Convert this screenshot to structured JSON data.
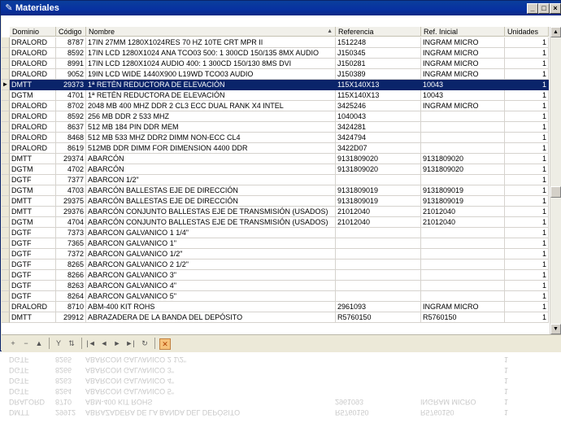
{
  "window": {
    "title": "Materiales",
    "app_icon": "pencil-icon",
    "controls": {
      "minimize": "_",
      "maximize": "□",
      "close": "×"
    }
  },
  "grid": {
    "columns": [
      "Dominio",
      "Código",
      "Nombre",
      "Referencia",
      "Ref. Inicial",
      "Unidades"
    ],
    "sort_indicator": "▲",
    "selected_row_marker": "►",
    "rows": [
      {
        "dominio": "DRALORD",
        "codigo": "8787",
        "nombre": "17IN 27MM 1280X1024RES 70 HZ 10TE CRT MPR II",
        "referencia": "1512248",
        "ref_inicial": "INGRAM MICRO",
        "unidades": "1"
      },
      {
        "dominio": "DRALORD",
        "codigo": "8592",
        "nombre": "17IN LCD 1280X1024 ANA TCO03 500: 1 300CD 150/135 8MX AUDIO",
        "referencia": "J150345",
        "ref_inicial": "INGRAM MICRO",
        "unidades": "1"
      },
      {
        "dominio": "DRALORD",
        "codigo": "8991",
        "nombre": "17IN LCD 1280X1024 AUDIO 400: 1 300CD 150/130 8MS DVI",
        "referencia": "J150281",
        "ref_inicial": "INGRAM MICRO",
        "unidades": "1"
      },
      {
        "dominio": "DRALORD",
        "codigo": "9052",
        "nombre": "19IN LCD WIDE 1440X900 L19WD TCO03 AUDIO",
        "referencia": "J150389",
        "ref_inicial": "INGRAM MICRO",
        "unidades": "1"
      },
      {
        "dominio": "DMTT",
        "codigo": "29373",
        "nombre": "1ª RETÉN REDUCTORA DE ELEVACIÓN",
        "referencia": "115X140X13",
        "ref_inicial": "10043",
        "unidades": "1"
      },
      {
        "dominio": "DGTM",
        "codigo": "4701",
        "nombre": "1ª RETÉN REDUCTORA DE ELEVACIÓN",
        "referencia": "115X140X13",
        "ref_inicial": "10043",
        "unidades": "1"
      },
      {
        "dominio": "DRALORD",
        "codigo": "8702",
        "nombre": "2048 MB 400 MHZ DDR 2 CL3 ECC DUAL RANK X4 INTEL",
        "referencia": "3425246",
        "ref_inicial": "INGRAM MICRO",
        "unidades": "1"
      },
      {
        "dominio": "DRALORD",
        "codigo": "8592",
        "nombre": "256 MB DDR 2 533 MHZ",
        "referencia": "1040043",
        "ref_inicial": "",
        "unidades": "1"
      },
      {
        "dominio": "DRALORD",
        "codigo": "8637",
        "nombre": "512 MB 184 PIN DDR  MEM",
        "referencia": "3424281",
        "ref_inicial": "",
        "unidades": "1"
      },
      {
        "dominio": "DRALORD",
        "codigo": "8468",
        "nombre": "512 MB 533 MHZ DDR2 DIMM NON-ECC CL4",
        "referencia": "3424794",
        "ref_inicial": "",
        "unidades": "1"
      },
      {
        "dominio": "DRALORD",
        "codigo": "8619",
        "nombre": "512MB DDR DIMM FOR DIMENSION 4400 DDR",
        "referencia": "3422D07",
        "ref_inicial": "",
        "unidades": "1"
      },
      {
        "dominio": "DMTT",
        "codigo": "29374",
        "nombre": "ABARCÓN",
        "referencia": "9131809020",
        "ref_inicial": "9131809020",
        "unidades": "1"
      },
      {
        "dominio": "DGTM",
        "codigo": "4702",
        "nombre": "ABARCÓN",
        "referencia": "9131809020",
        "ref_inicial": "9131809020",
        "unidades": "1"
      },
      {
        "dominio": "DGTF",
        "codigo": "7377",
        "nombre": "ABARCON 1/2\"",
        "referencia": "",
        "ref_inicial": "",
        "unidades": "1"
      },
      {
        "dominio": "DGTM",
        "codigo": "4703",
        "nombre": "ABARCÓN BALLESTAS EJE DE DIRECCIÓN",
        "referencia": "9131809019",
        "ref_inicial": "9131809019",
        "unidades": "1"
      },
      {
        "dominio": "DMTT",
        "codigo": "29375",
        "nombre": "ABARCÓN BALLESTAS EJE DE DIRECCIÓN",
        "referencia": "9131809019",
        "ref_inicial": "9131809019",
        "unidades": "1"
      },
      {
        "dominio": "DMTT",
        "codigo": "29376",
        "nombre": "ABARCÓN CONJUNTO BALLESTAS EJE DE TRANSMISIÓN  (USADOS)",
        "referencia": "21012040",
        "ref_inicial": "21012040",
        "unidades": "1"
      },
      {
        "dominio": "DGTM",
        "codigo": "4704",
        "nombre": "ABARCÓN CONJUNTO BALLESTAS EJE DE TRANSMISIÓN  (USADOS)",
        "referencia": "21012040",
        "ref_inicial": "21012040",
        "unidades": "1"
      },
      {
        "dominio": "DGTF",
        "codigo": "7373",
        "nombre": "ABARCON GALVANICO 1 1/4\"",
        "referencia": "",
        "ref_inicial": "",
        "unidades": "1"
      },
      {
        "dominio": "DGTF",
        "codigo": "7365",
        "nombre": "ABARCON GALVANICO 1\"",
        "referencia": "",
        "ref_inicial": "",
        "unidades": "1"
      },
      {
        "dominio": "DGTF",
        "codigo": "7372",
        "nombre": "ABARCON GALVANICO 1/2\"",
        "referencia": "",
        "ref_inicial": "",
        "unidades": "1"
      },
      {
        "dominio": "DGTF",
        "codigo": "8265",
        "nombre": "ABARCON GALVANICO 2 1/2\"",
        "referencia": "",
        "ref_inicial": "",
        "unidades": "1"
      },
      {
        "dominio": "DGTF",
        "codigo": "8266",
        "nombre": "ABARCON GALVANICO 3\"",
        "referencia": "",
        "ref_inicial": "",
        "unidades": "1"
      },
      {
        "dominio": "DGTF",
        "codigo": "8263",
        "nombre": "ABARCON GALVANICO 4\"",
        "referencia": "",
        "ref_inicial": "",
        "unidades": "1"
      },
      {
        "dominio": "DGTF",
        "codigo": "8264",
        "nombre": "ABARCON GALVANICO 5\"",
        "referencia": "",
        "ref_inicial": "",
        "unidades": "1"
      },
      {
        "dominio": "DRALORD",
        "codigo": "8710",
        "nombre": "ABM-400 KIT ROHS",
        "referencia": "2961093",
        "ref_inicial": "INGRAM MICRO",
        "unidades": "1"
      },
      {
        "dominio": "DMTT",
        "codigo": "29912",
        "nombre": "ABRAZADERA  DE LA BANDA DEL DEPÓSITO",
        "referencia": "R5760150",
        "ref_inicial": "R5760150",
        "unidades": "1"
      }
    ],
    "selected_index": 4
  },
  "toolbar": {
    "icons": [
      "add-record-icon",
      "delete-record-icon",
      "edit-record-icon",
      "filter-icon",
      "sort-icon",
      "first-record-icon",
      "prev-record-icon",
      "next-record-icon",
      "last-record-icon",
      "refresh-icon",
      "cancel-icon"
    ],
    "glyphs": {
      "add": "+",
      "delete": "−",
      "edit": "▲",
      "filter": "Y",
      "sort": "⇅",
      "first": "|◄",
      "prev": "◄",
      "next": "►",
      "last": "►|",
      "refresh": "↻",
      "cancel": "✕"
    }
  },
  "colors": {
    "selection": "#0a246a",
    "titlebar": "#0831a0"
  }
}
